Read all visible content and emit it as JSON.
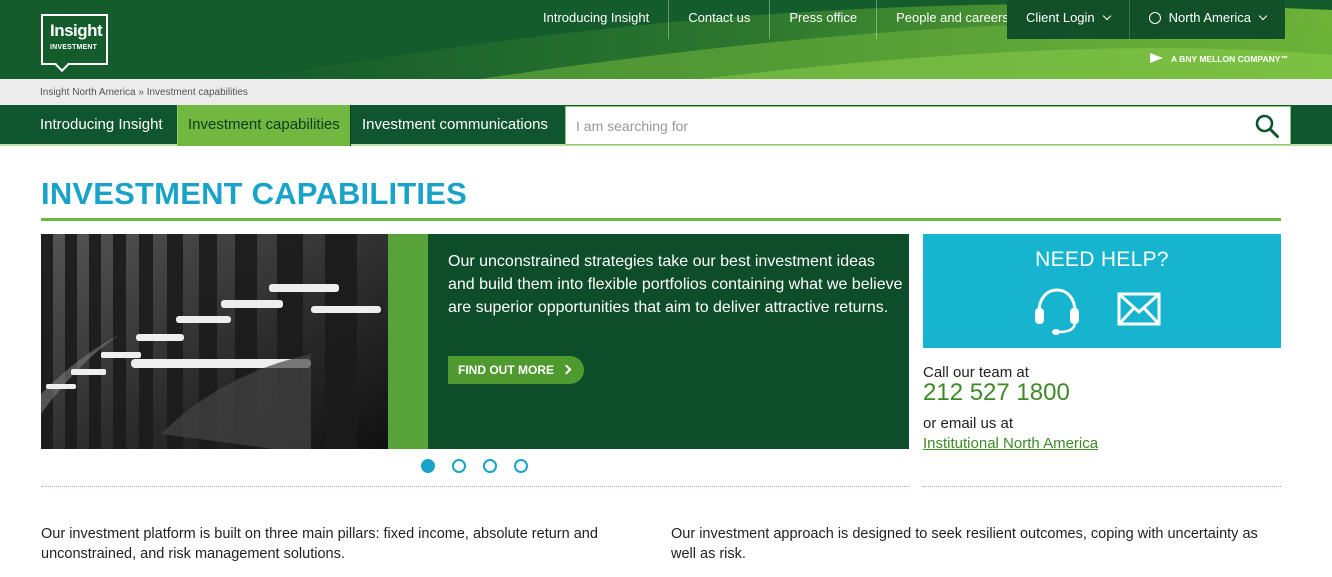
{
  "logo": {
    "line1": "Insight",
    "line2": "INVESTMENT"
  },
  "topnav": {
    "items": [
      "Introducing Insight",
      "Contact us",
      "Press office",
      "People and careers"
    ],
    "client_login": "Client Login",
    "region": "North America"
  },
  "bny": "A BNY MELLON COMPANY℠",
  "breadcrumb": "Insight North America » Investment capabilities",
  "mainnav": {
    "items": [
      "Introducing Insight",
      "Investment capabilities",
      "Investment communications"
    ],
    "active_index": 1
  },
  "search": {
    "placeholder": "I am searching for",
    "value": ""
  },
  "page": {
    "title": "INVESTMENT CAPABILITIES"
  },
  "carousel": {
    "caption": "Our unconstrained strategies take our best investment ideas and build them into flexible portfolios containing what we believe are superior opportunities that aim to deliver attractive returns.",
    "button": "FIND OUT MORE",
    "slide_count": 4,
    "active_slide": 1
  },
  "help": {
    "title": "NEED HELP?",
    "call_label": "Call our team at",
    "phone": "212 527 1800",
    "email_label": "or email us at",
    "email_link": "Institutional North America"
  },
  "body": {
    "left": "Our investment platform is built on three main pillars: fixed income, absolute return and unconstrained, and  risk management solutions.",
    "right": "Our investment approach is designed to seek resilient outcomes, coping with uncertainty as well as risk."
  },
  "colors": {
    "header_green": "#155c2c",
    "nav_green": "#0f5530",
    "accent_light_green": "#72b73f",
    "title_blue": "#1aa3c8",
    "help_blue": "#17b4cf",
    "phone_green": "#3d8a26"
  }
}
